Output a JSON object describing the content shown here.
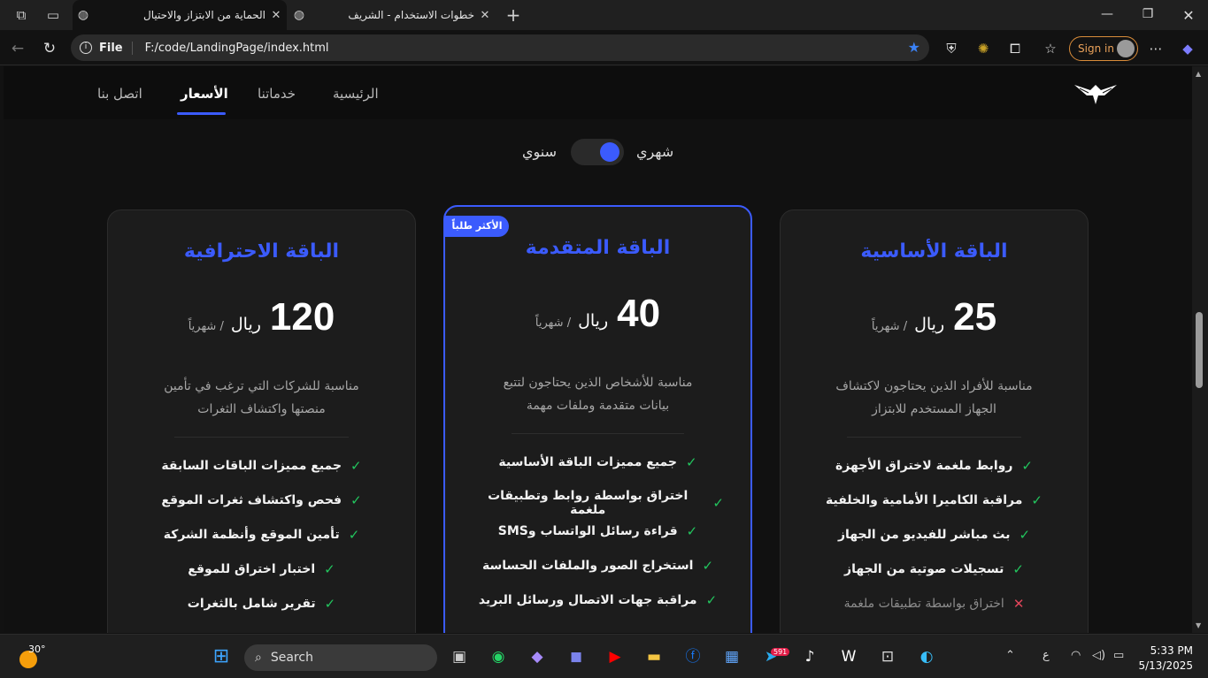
{
  "browser": {
    "tabs": [
      {
        "title": "الحماية من الابتزاز والاحتيال",
        "active": true
      },
      {
        "title": "خطوات الاستخدام - الشريف",
        "active": false
      }
    ],
    "address": {
      "scheme_label": "File",
      "url": "F:/code/LandingPage/index.html"
    },
    "signin_label": "Sign in"
  },
  "nav": {
    "items": [
      "الرئيسية",
      "خدماتنا",
      "الأسعار",
      "اتصل بنا"
    ],
    "active": "الأسعار"
  },
  "billing_toggle": {
    "monthly_label": "شهري",
    "yearly_label": "سنوي"
  },
  "plans": [
    {
      "title": "الباقة الأساسية",
      "price": "25",
      "currency": "ريال",
      "period": "/ شهرياً",
      "description": "مناسبة للأفراد الذين يحتاجون لاكتشاف الجهاز المستخدم للابتزاز",
      "features": [
        {
          "text": "روابط ملغمة لاختراق الأجهزة",
          "included": true
        },
        {
          "text": "مراقبة الكاميرا الأمامية والخلفية",
          "included": true
        },
        {
          "text": "بث مباشر للفيديو من الجهاز",
          "included": true
        },
        {
          "text": "تسجيلات صوتية من الجهاز",
          "included": true
        },
        {
          "text": "اختراق بواسطة تطبيقات ملغمة",
          "included": false
        }
      ]
    },
    {
      "title": "الباقة المتقدمة",
      "badge": "الأكثر طلباً",
      "price": "40",
      "currency": "ريال",
      "period": "/ شهرياً",
      "description": "مناسبة للأشخاص الذين يحتاجون لتتبع بيانات متقدمة وملفات مهمة",
      "features": [
        {
          "text": "جميع مميزات الباقة الأساسية",
          "included": true
        },
        {
          "text": "اختراق بواسطة روابط وتطبيقات ملغمة",
          "included": true
        },
        {
          "text": "قراءة رسائل الواتساب وSMS",
          "included": true
        },
        {
          "text": "استخراج الصور والملفات الحساسة",
          "included": true
        },
        {
          "text": "مراقبة جهات الاتصال ورسائل البريد",
          "included": true
        }
      ]
    },
    {
      "title": "الباقة الاحترافية",
      "price": "120",
      "currency": "ريال",
      "period": "/ شهرياً",
      "description": "مناسبة للشركات التي ترغب في تأمين منصتها واكتشاف الثغرات",
      "features": [
        {
          "text": "جميع مميزات الباقات السابقة",
          "included": true
        },
        {
          "text": "فحص واكتشاف ثغرات الموقع",
          "included": true
        },
        {
          "text": "تأمين الموقع وأنظمة الشركة",
          "included": true
        },
        {
          "text": "اختبار اختراق للموقع",
          "included": true
        },
        {
          "text": "تقرير شامل بالثغرات",
          "included": true
        }
      ]
    }
  ],
  "taskbar": {
    "weather": "30°",
    "search_label": "Search",
    "telegram_badge": "591",
    "lang": "ع",
    "time": "5:33 PM",
    "date": "5/13/2025"
  }
}
